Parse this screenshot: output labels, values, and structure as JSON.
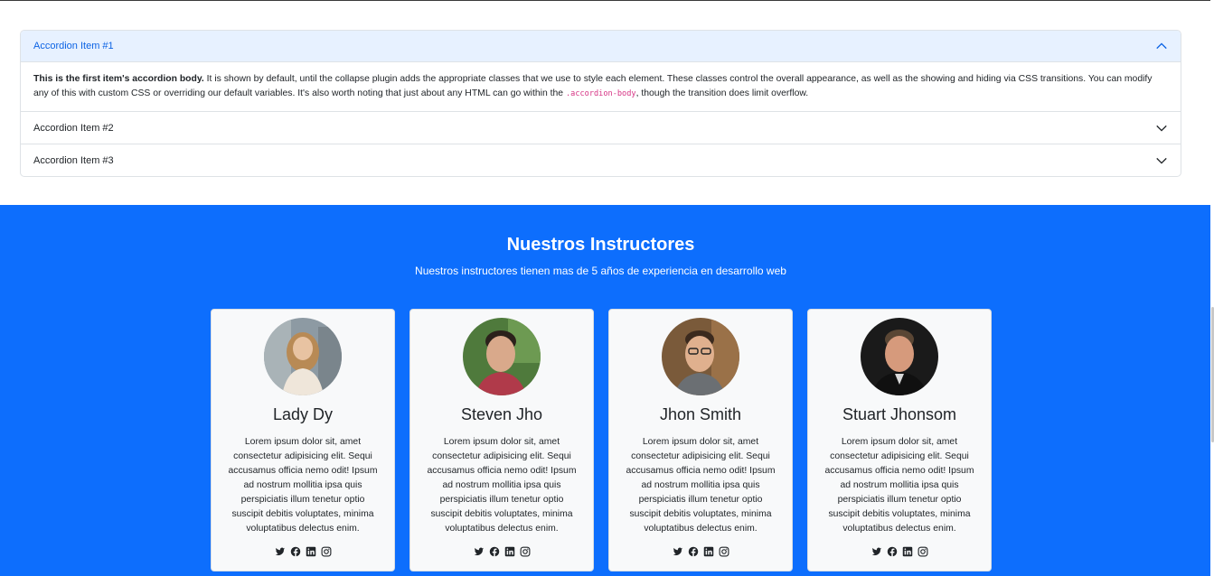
{
  "accordion": {
    "items": [
      {
        "title": "Accordion Item #1",
        "body_strong": "This is the first item's accordion body.",
        "body_text": " It is shown by default, until the collapse plugin adds the appropriate classes that we use to style each element. These classes control the overall appearance, as well as the showing and hiding via CSS transitions. You can modify any of this with custom CSS or overriding our default variables. It's also worth noting that just about any HTML can go within the ",
        "body_code": ".accordion-body",
        "body_tail": ", though the transition does limit overflow.",
        "expanded": true
      },
      {
        "title": "Accordion Item #2",
        "expanded": false
      },
      {
        "title": "Accordion Item #3",
        "expanded": false
      }
    ]
  },
  "instructors": {
    "title": "Nuestros Instructores",
    "subtitle": "Nuestros instructores tienen mas de 5 años de experiencia en desarrollo web",
    "background_color": "#0d6efd",
    "cards": [
      {
        "name": "Lady Dy",
        "text": "Lorem ipsum dolor sit, amet consectetur adipisicing elit. Sequi accusamus officia nemo odit! Ipsum ad nostrum mollitia ipsa quis perspiciatis illum tenetur optio suscipit debitis voluptates, minima voluptatibus delectus enim.",
        "socials": [
          "twitter-icon",
          "facebook-icon",
          "linkedin-icon",
          "instagram-icon"
        ]
      },
      {
        "name": "Steven Jho",
        "text": "Lorem ipsum dolor sit, amet consectetur adipisicing elit. Sequi accusamus officia nemo odit! Ipsum ad nostrum mollitia ipsa quis perspiciatis illum tenetur optio suscipit debitis voluptates, minima voluptatibus delectus enim.",
        "socials": [
          "twitter-icon",
          "facebook-icon",
          "linkedin-icon",
          "instagram-icon"
        ]
      },
      {
        "name": "Jhon Smith",
        "text": "Lorem ipsum dolor sit, amet consectetur adipisicing elit. Sequi accusamus officia nemo odit! Ipsum ad nostrum mollitia ipsa quis perspiciatis illum tenetur optio suscipit debitis voluptates, minima voluptatibus delectus enim.",
        "socials": [
          "twitter-icon",
          "facebook-icon",
          "linkedin-icon",
          "instagram-icon"
        ]
      },
      {
        "name": "Stuart Jhonsom",
        "text": "Lorem ipsum dolor sit, amet consectetur adipisicing elit. Sequi accusamus officia nemo odit! Ipsum ad nostrum mollitia ipsa quis perspiciatis illum tenetur optio suscipit debitis voluptates, minima voluptatibus delectus enim.",
        "socials": [
          "twitter-icon",
          "facebook-icon",
          "linkedin-icon",
          "instagram-icon"
        ]
      }
    ]
  }
}
